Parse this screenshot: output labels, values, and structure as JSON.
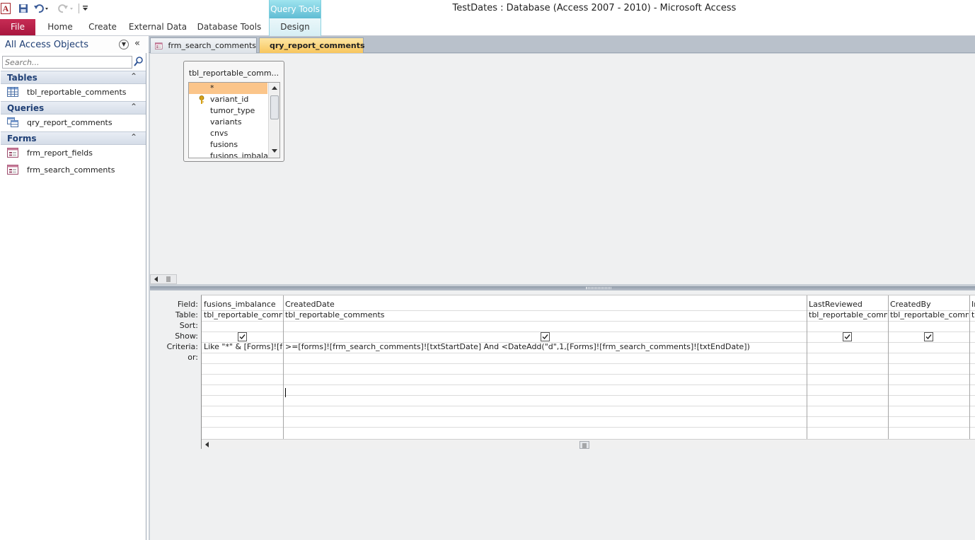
{
  "window": {
    "title": "TestDates : Database (Access 2007 - 2010)  -  Microsoft Access",
    "app_icon_letter": "A"
  },
  "ribbon": {
    "file_tab": "File",
    "tabs": [
      "Home",
      "Create",
      "External Data",
      "Database Tools"
    ],
    "contextual_group": "Query Tools",
    "contextual_tab": "Design"
  },
  "nav_pane": {
    "title": "All Access Objects",
    "search_placeholder": "Search...",
    "groups": [
      {
        "label": "Tables",
        "items": [
          "tbl_reportable_comments"
        ]
      },
      {
        "label": "Queries",
        "items": [
          "qry_report_comments"
        ]
      },
      {
        "label": "Forms",
        "items": [
          "frm_report_fields",
          "frm_search_comments"
        ]
      }
    ]
  },
  "document_tabs": [
    {
      "label": "frm_search_comments",
      "active": false
    },
    {
      "label": "qry_report_comments",
      "active": true
    }
  ],
  "table_box": {
    "title": "tbl_reportable_comm...",
    "fields": [
      "*",
      "variant_id",
      "tumor_type",
      "variants",
      "cnvs",
      "fusions",
      "fusions_imbalance"
    ]
  },
  "design_grid": {
    "row_labels": [
      "Field:",
      "Table:",
      "Sort:",
      "Show:",
      "Criteria:",
      "or:"
    ],
    "columns": [
      {
        "field": "fusions_imbalance",
        "table": "tbl_reportable_comments",
        "show": true,
        "criteria": "Like \"*\" & [Forms]![frm_search_comments]"
      },
      {
        "field": "CreatedDate",
        "table": "tbl_reportable_comments",
        "show": true,
        "criteria": ">=[forms]![frm_search_comments]![txtStartDate] And <DateAdd(\"d\",1,[Forms]![frm_search_comments]![txtEndDate])"
      },
      {
        "field": "LastReviewed",
        "table": "tbl_reportable_comments",
        "show": true,
        "criteria": ""
      },
      {
        "field": "CreatedBy",
        "table": "tbl_reportable_comments",
        "show": true,
        "criteria": ""
      },
      {
        "field": "Ir",
        "table": "tb",
        "show": true,
        "criteria": ""
      }
    ]
  },
  "colors": {
    "file_tab": "#b51d47",
    "contextual": "#5fbcd3",
    "active_doc_tab": "#f8c65d",
    "selected_field": "#fbc58a"
  }
}
